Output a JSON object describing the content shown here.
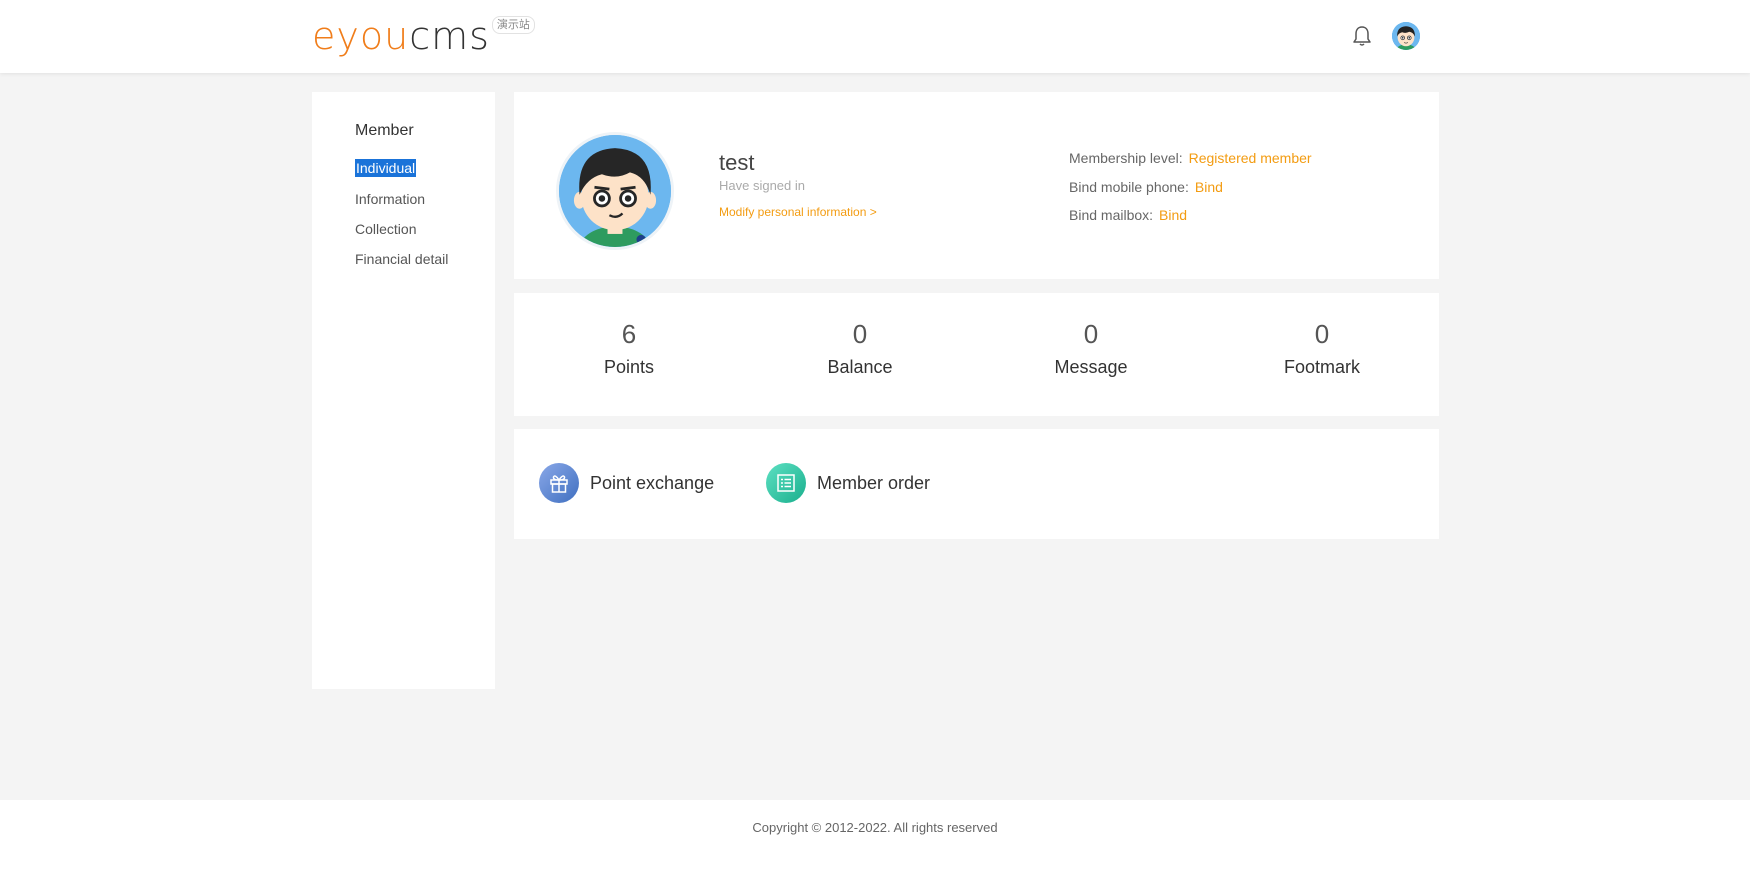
{
  "header": {
    "logo": {
      "part1": "eyou",
      "part2": "cms"
    },
    "demo_tag": "演示站",
    "icons": [
      "bell-icon",
      "user-avatar"
    ]
  },
  "sidebar": {
    "title": "Member",
    "items": [
      {
        "label": "Individual",
        "active": true
      },
      {
        "label": "Information",
        "active": false
      },
      {
        "label": "Collection",
        "active": false
      },
      {
        "label": "Financial detail",
        "active": false
      }
    ]
  },
  "profile": {
    "username": "test",
    "status": "Have signed in",
    "modify_link": "Modify personal information >",
    "membership_label": "Membership level:",
    "membership_value": "Registered member",
    "mobile_label": "Bind mobile phone:",
    "mobile_value": "Bind",
    "mailbox_label": "Bind mailbox:",
    "mailbox_value": "Bind"
  },
  "stats": [
    {
      "value": "6",
      "label": "Points"
    },
    {
      "value": "0",
      "label": "Balance"
    },
    {
      "value": "0",
      "label": "Message"
    },
    {
      "value": "0",
      "label": "Footmark"
    }
  ],
  "actions": [
    {
      "label": "Point exchange",
      "icon": "gift-icon"
    },
    {
      "label": "Member order",
      "icon": "list-icon"
    }
  ],
  "footer": {
    "copyright": "Copyright © 2012-2022. All rights reserved"
  },
  "colors": {
    "accent": "#f39c12",
    "logo_orange": "#f07d1a",
    "active_highlight": "#1a73d9",
    "background": "#f4f4f4"
  }
}
